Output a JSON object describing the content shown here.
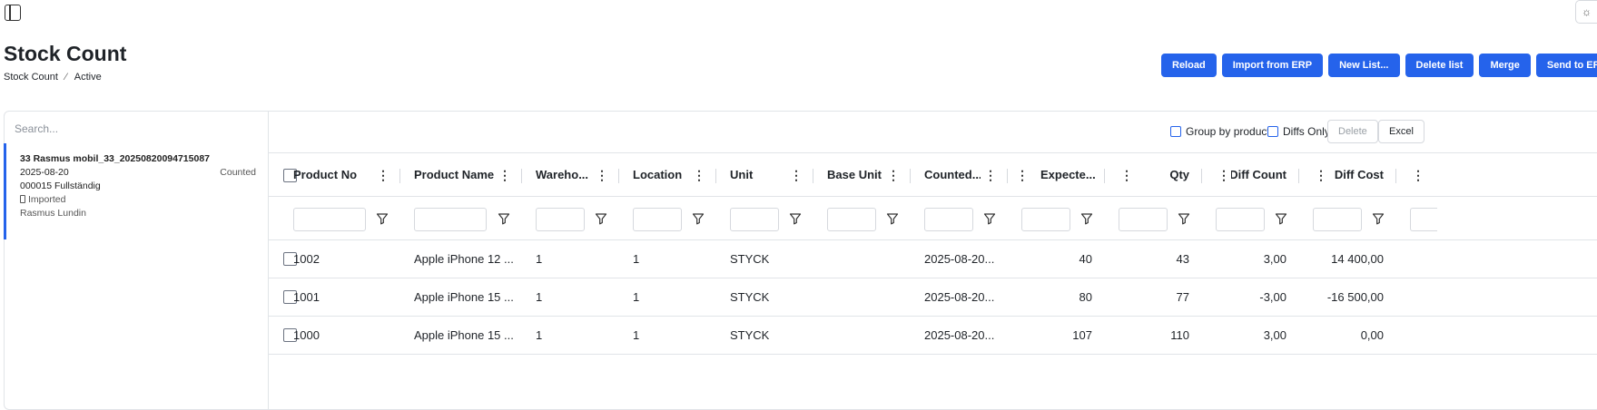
{
  "page": {
    "title": "Stock Count",
    "breadcrumb": [
      "Stock Count",
      "Active"
    ]
  },
  "actions": [
    "Reload",
    "Import from ERP",
    "New List...",
    "Delete list",
    "Merge",
    "Send to ERP"
  ],
  "sidebar": {
    "search_placeholder": "Search...",
    "lists": [
      {
        "name": "33 Rasmus mobil_33_20250820094715087",
        "date": "2025-08-20",
        "status": "Counted",
        "number": "000015 Fullständig",
        "import_state": "Imported",
        "user": "Rasmus Lundin"
      }
    ]
  },
  "toolbar": {
    "group_by_product": "Group by product",
    "diffs_only": "Diffs Only",
    "delete": "Delete",
    "excel": "Excel"
  },
  "grid": {
    "columns": [
      "Product No",
      "Product Name",
      "Wareho...",
      "Location",
      "Unit",
      "Base Unit",
      "Counted...",
      "Expecte...",
      "Qty",
      "Diff Count",
      "Diff Cost"
    ],
    "rows": [
      [
        "1002",
        "Apple iPhone 12 ...",
        "1",
        "1",
        "STYCK",
        "",
        "2025-08-20...",
        "40",
        "43",
        "3,00",
        "14 400,00"
      ],
      [
        "1001",
        "Apple iPhone 15 ...",
        "1",
        "1",
        "STYCK",
        "",
        "2025-08-20...",
        "80",
        "77",
        "-3,00",
        "-16 500,00"
      ],
      [
        "1000",
        "Apple iPhone 15 ...",
        "1",
        "1",
        "STYCK",
        "",
        "2025-08-20...",
        "107",
        "110",
        "3,00",
        "0,00"
      ]
    ]
  },
  "colors": {
    "primary": "#2563eb",
    "border": "#e1e4e8"
  }
}
